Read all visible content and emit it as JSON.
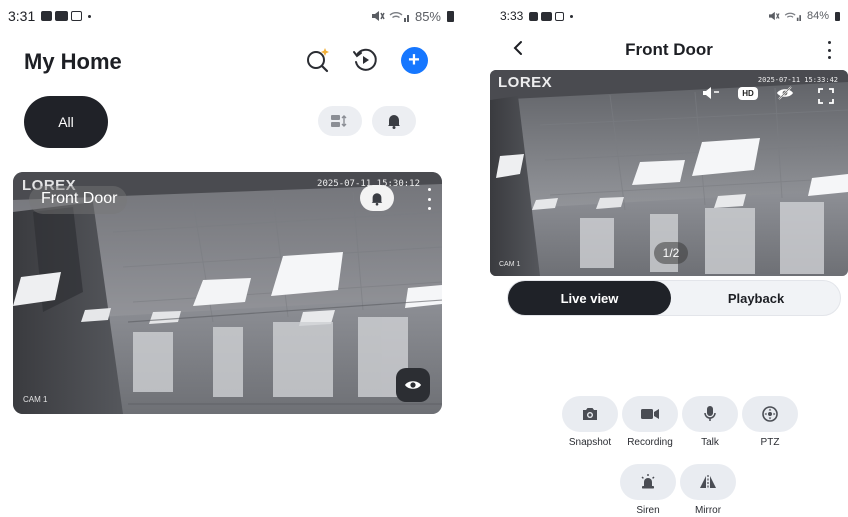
{
  "left": {
    "status": {
      "time": "3:31",
      "battery": "85%"
    },
    "title": "My Home",
    "filter_chip": "All",
    "camera": {
      "logo": "LOREX",
      "name": "Front Door",
      "timestamp": "2025-07-11 15:30:12",
      "label": "CAM 1"
    }
  },
  "right": {
    "status": {
      "time": "3:33",
      "battery": "84%"
    },
    "title": "Front Door",
    "live": {
      "logo": "LOREX",
      "timestamp": "2025-07-11 15:33:42",
      "hd": "HD",
      "pager": "1/2",
      "label": "CAM 1"
    },
    "tabs": {
      "live": "Live view",
      "playback": "Playback"
    },
    "tools": [
      {
        "label": "Snapshot",
        "icon": "camera-icon"
      },
      {
        "label": "Recording",
        "icon": "video-icon"
      },
      {
        "label": "Talk",
        "icon": "mic-icon"
      },
      {
        "label": "PTZ",
        "icon": "ptz-icon"
      },
      {
        "label": "Siren",
        "icon": "siren-icon"
      },
      {
        "label": "Mirror",
        "icon": "mirror-icon"
      }
    ]
  },
  "colors": {
    "accent": "#1677ff",
    "dark": "#202228",
    "pill": "#e9ecf1"
  }
}
